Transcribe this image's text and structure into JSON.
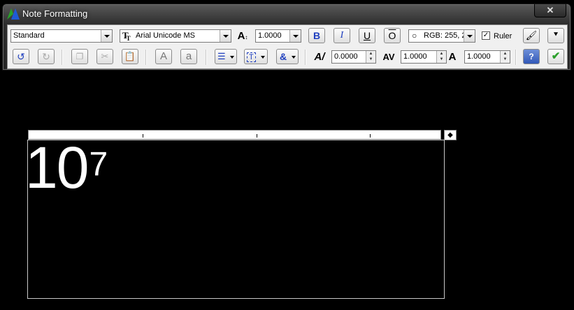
{
  "window": {
    "title": "Note Formatting",
    "close_glyph": "✕"
  },
  "row1": {
    "style_value": "Standard",
    "font_value": "Arial Unicode MS",
    "font_icon": "truetype-icon",
    "text_height_value": "1.0000",
    "bold_label": "B",
    "italic_label": "I",
    "underline_label": "U",
    "overline_label": "O",
    "color_value": "RGB: 255, 2",
    "ruler_label": "Ruler",
    "ruler_checked": true
  },
  "row2": {
    "uppercase_label": "A",
    "lowercase_label": "a",
    "oblique_value": "0.0000",
    "tracking_value": "1.0000",
    "width_value": "1.0000",
    "help_label": "?",
    "ok_glyph": "✔"
  },
  "canvas": {
    "note_base": "10",
    "note_superscript": "7"
  },
  "colors": {
    "accent_blue": "#1f3fbf",
    "ok_green": "#2ca02c"
  }
}
